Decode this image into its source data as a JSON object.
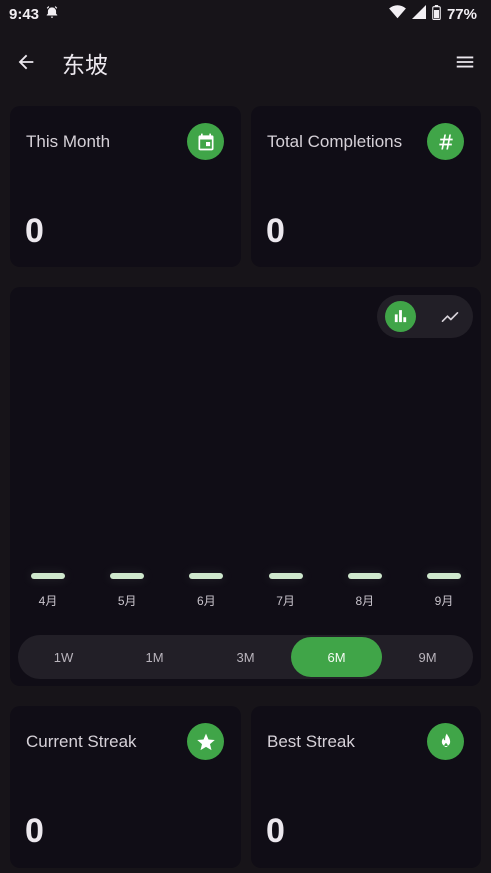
{
  "status": {
    "time": "9:43",
    "battery": "77%"
  },
  "appbar": {
    "title": "东坡"
  },
  "stats": {
    "this_month": {
      "label": "This Month",
      "value": "0"
    },
    "total_completions": {
      "label": "Total Completions",
      "value": "0"
    },
    "current_streak": {
      "label": "Current Streak",
      "value": "0"
    },
    "best_streak": {
      "label": "Best Streak",
      "value": "0"
    }
  },
  "chart": {
    "view_modes": [
      "bar-chart-icon",
      "line-chart-icon"
    ],
    "selected_view": "bar",
    "accent": "#40a548"
  },
  "chart_data": {
    "type": "bar",
    "categories": [
      "4月",
      "5月",
      "6月",
      "7月",
      "8月",
      "9月"
    ],
    "values": [
      0,
      0,
      0,
      0,
      0,
      0
    ]
  },
  "ranges": {
    "items": [
      "1W",
      "1M",
      "3M",
      "6M",
      "9M"
    ],
    "selected": "6M"
  }
}
